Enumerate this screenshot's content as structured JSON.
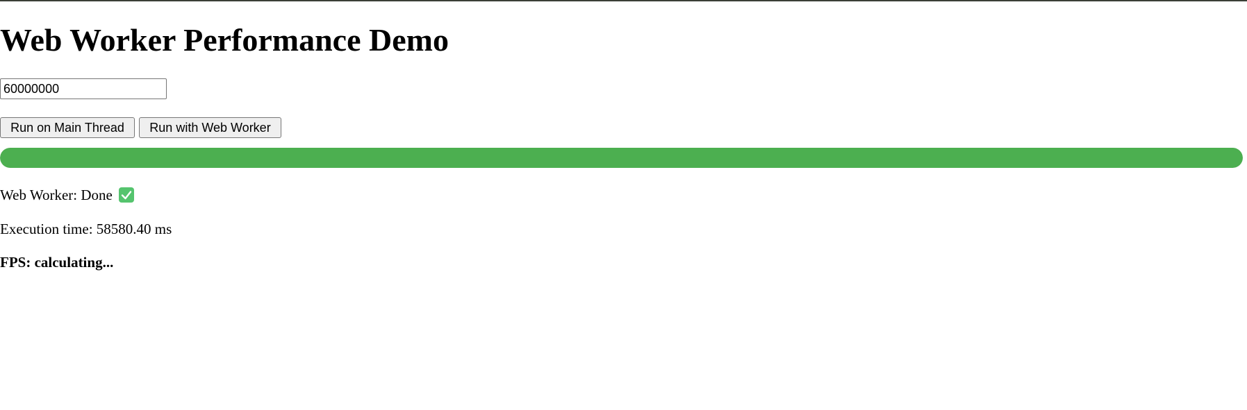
{
  "page": {
    "title": "Web Worker Performance Demo"
  },
  "controls": {
    "iterations_value": "60000000",
    "main_thread_label": "Run on Main Thread",
    "worker_label": "Run with Web Worker"
  },
  "progress": {
    "percent": 100,
    "color": "#4caf50"
  },
  "status": {
    "text": "Web Worker: Done",
    "icon": "check-mark-button-icon",
    "execution_time": "Execution time: 58580.40 ms",
    "fps": "FPS: calculating..."
  }
}
